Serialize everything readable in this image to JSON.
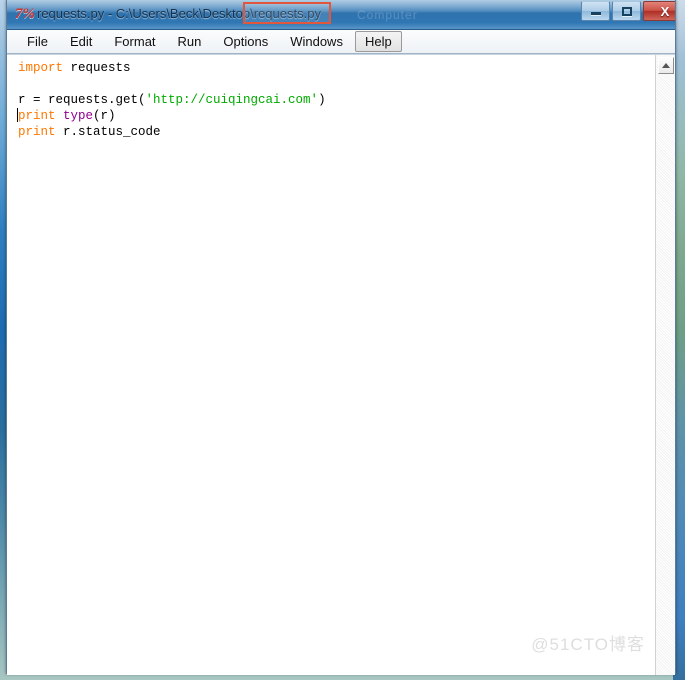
{
  "window": {
    "app_icon": "python-idle-icon",
    "title": "requests.py - C:\\Users\\Beck\\Desktop\\requests.py",
    "title_ghost": "Computer",
    "annotated_fragment": "requests.py",
    "annotation_color": "#e2563c",
    "controls": {
      "minimize_label": "Minimize",
      "maximize_label": "Maximize",
      "close_label": "X"
    }
  },
  "menubar": {
    "items": [
      {
        "label": "File",
        "hovered": false
      },
      {
        "label": "Edit",
        "hovered": false
      },
      {
        "label": "Format",
        "hovered": false
      },
      {
        "label": "Run",
        "hovered": false
      },
      {
        "label": "Options",
        "hovered": false
      },
      {
        "label": "Windows",
        "hovered": false
      },
      {
        "label": "Help",
        "hovered": true
      }
    ]
  },
  "editor": {
    "lines": [
      [
        {
          "text": "import",
          "type": "keyword"
        },
        {
          "text": " requests",
          "type": "plain"
        }
      ],
      [
        {
          "text": "",
          "type": "plain"
        }
      ],
      [
        {
          "text": "r = requests.get(",
          "type": "plain"
        },
        {
          "text": "'http://cuiqingcai.com'",
          "type": "string"
        },
        {
          "text": ")",
          "type": "plain"
        }
      ],
      [
        {
          "text": "print",
          "type": "keyword"
        },
        {
          "text": " ",
          "type": "plain"
        },
        {
          "text": "type",
          "type": "builtin"
        },
        {
          "text": "(r)",
          "type": "plain"
        }
      ],
      [
        {
          "text": "print",
          "type": "keyword"
        },
        {
          "text": " r.status_code",
          "type": "plain"
        }
      ]
    ],
    "colors": {
      "keyword": "#ff7700",
      "builtin": "#900090",
      "string": "#00aa00",
      "plain": "#000000",
      "background": "#ffffff"
    }
  },
  "scrollbar": {
    "up_arrow_label": "scroll-up"
  },
  "watermark": {
    "text": "@51CTO博客"
  }
}
